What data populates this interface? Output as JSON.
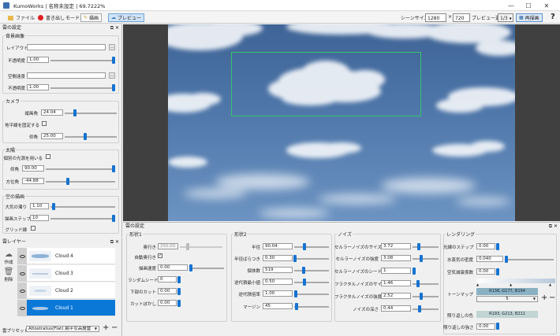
{
  "window": {
    "title": "KumoWorks | 名称未設定 | 69.7222%",
    "minimize": "—",
    "maximize": "☐",
    "close": "✕"
  },
  "toolbar": {
    "file": "ファイル",
    "export": "書き出し",
    "mode_label": "モード:",
    "draw": "描画",
    "preview": "プレビュー",
    "scene_size_label": "シーンサイズ:",
    "scene_w": "1280",
    "times": "×",
    "scene_h": "720",
    "preview_select_label": "プレビュー選択:",
    "preview_select_value": "1/3",
    "redraw": "再描画",
    "help": "?"
  },
  "cloud_settings": {
    "panel_title": "雲の設定",
    "bg_group": "背景画像",
    "layout_label": "レイアウト",
    "opacity_label": "不透明度",
    "opacity1": "1.00",
    "space_label": "空間遠景",
    "opacity2": "1.00",
    "browse": "...",
    "camera_group": "カメラ",
    "fov_label": "縦画角",
    "fov": "24.04",
    "fix_horizon_label": "地平線を固定する",
    "pitch_label": "仰角",
    "pitch": "25.00",
    "sun_group": "太陽",
    "sun_backlight_label": "個別の光源を用いる",
    "elev_label": "仰角",
    "elev": "90.00",
    "azim_label": "方位角",
    "azim": "-44.88",
    "sky_group": "空の描画",
    "haze_label": "大気の濁り",
    "haze": "1.10",
    "steps_label": "描画ステップ",
    "steps": "10",
    "grid_label": "グリッド線"
  },
  "layers": {
    "panel_title": "雲レイヤー",
    "create": "作成",
    "delete": "削除",
    "items": [
      {
        "name": "Cloud 4"
      },
      {
        "name": "Cloud 3"
      },
      {
        "name": "Cloud 2"
      },
      {
        "name": "Cloud 1"
      }
    ],
    "preset_label": "雲プリセット:",
    "preset_value": "Altostratus(Flat) 扁平な高層雲",
    "add": "+",
    "remove": "−"
  },
  "cloud_props": {
    "panel_title": "雲の設定",
    "shape1": {
      "title": "形状1",
      "depth_label": "奥行き",
      "depth": "250.00",
      "auto_depth_label": "自動奥行き",
      "draw_speed_label": "描画速度",
      "draw_speed": "0.00",
      "random_seed_label": "ランダムシード",
      "random_seed": "0",
      "bottom_cut_label": "下部のカット",
      "bottom_cut": "0.00",
      "cut_blur_label": "カットぼかし",
      "cut_blur": "0.00"
    },
    "shape2": {
      "title": "形状2",
      "radius_label": "半径",
      "radius": "90.04",
      "radius_var_label": "半径ばらつき",
      "radius_var": "0.30",
      "density_label": "個体数",
      "density": "519",
      "min_scale_label": "逆代積最小値",
      "min_scale": "0.50",
      "scale_label": "逆代積倍率",
      "scale": "1.00",
      "margin_label": "マージン",
      "margin": "45"
    },
    "noise": {
      "title": "ノイズ",
      "cell_size_label": "セルラーノイズのサイズ",
      "cell_size": "3.72",
      "cell_strength_label": "セルラーノイズの強度",
      "cell_strength": "3.08",
      "cell_seed_label": "セルラーノイズのシード",
      "cell_seed": "1",
      "fractal_size_label": "フラクタルノイズのサイズ",
      "fractal_size": "1.46",
      "fractal_strength_label": "フラクタルノイズの強度",
      "fractal_strength": "2.52",
      "depth_label": "ノイズの深さ",
      "depth": "0.44"
    },
    "render": {
      "title": "レンダリング",
      "light_steps_label": "光線のステップ",
      "light_steps": "0.00",
      "density_label": "水蒸気の密度",
      "density": "0.040",
      "light_atten_label": "空気減衰係数",
      "light_atten": "0.00",
      "tonemap_label": "トーンマップ",
      "tone_color": "R138, G177, B194",
      "tone_value": "5",
      "backlight_color_label": "照り返しの色",
      "backlight_color": "R193, G213, B211",
      "backlight_strength_label": "照り返しの強さ",
      "backlight_strength": "0.00",
      "plus": "+",
      "minus": "−"
    }
  }
}
